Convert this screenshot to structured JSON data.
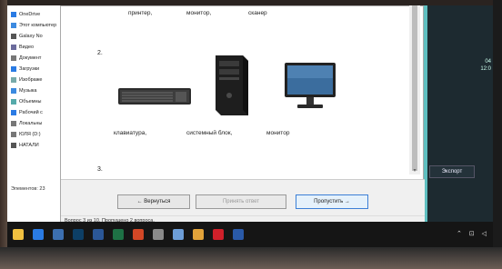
{
  "explorer": {
    "items": [
      {
        "label": "OneDrive",
        "icon": "cloud-icon",
        "color": "#2a7be4"
      },
      {
        "label": "Этот компьютер",
        "icon": "computer-icon",
        "color": "#3c8ae0"
      },
      {
        "label": "Galaxy No",
        "icon": "phone-icon",
        "color": "#555"
      },
      {
        "label": "Видео",
        "icon": "video-icon",
        "color": "#6b6b9c"
      },
      {
        "label": "Документ",
        "icon": "document-icon",
        "color": "#777"
      },
      {
        "label": "Загрузки",
        "icon": "download-icon",
        "color": "#2a7be4"
      },
      {
        "label": "Изображе",
        "icon": "image-icon",
        "color": "#7aa"
      },
      {
        "label": "Музыка",
        "icon": "music-icon",
        "color": "#3c8ae0"
      },
      {
        "label": "Объемны",
        "icon": "cube-icon",
        "color": "#5aa"
      },
      {
        "label": "Рабочий с",
        "icon": "desktop-icon",
        "color": "#2a7be4"
      },
      {
        "label": "Локальны",
        "icon": "drive-icon",
        "color": "#777"
      },
      {
        "label": "ЮЛЯ (D:)",
        "icon": "drive-icon",
        "color": "#777"
      },
      {
        "label": "НАТАЛИ",
        "icon": "usb-icon",
        "color": "#555"
      }
    ],
    "status": "Элементов: 23"
  },
  "question": {
    "top_captions": [
      "принтер,",
      "монитор,",
      "сканер"
    ],
    "item2_number": "2.",
    "item2_captions": [
      "клавиатура,",
      "системный блок,",
      "монитор"
    ],
    "item3_number": "3."
  },
  "buttons": {
    "back": "← Вернуться",
    "accept": "Принять ответ",
    "skip": "Пропустить →"
  },
  "progress_text": "Вопрос 3 из 10. Пропущено 2 вопроса.",
  "side": {
    "export_label": "Экспорт",
    "clock": "04 12:0"
  },
  "taskbar": {
    "icons": [
      {
        "name": "explorer-icon",
        "color": "#f0c040"
      },
      {
        "name": "mail-icon",
        "color": "#2a7be4"
      },
      {
        "name": "terminal-icon",
        "color": "#3c6fb0"
      },
      {
        "name": "photoshop-icon",
        "color": "#0d3f66"
      },
      {
        "name": "word-icon",
        "color": "#2b5797"
      },
      {
        "name": "excel-icon",
        "color": "#1e7145"
      },
      {
        "name": "powerpoint-icon",
        "color": "#d24726"
      },
      {
        "name": "calculator-icon",
        "color": "#8a8a8a"
      },
      {
        "name": "paint-icon",
        "color": "#6d9ed8"
      },
      {
        "name": "chrome-icon",
        "color": "#e2a33a"
      },
      {
        "name": "opera-icon",
        "color": "#d0202a"
      },
      {
        "name": "help-icon",
        "color": "#2a5aa8"
      }
    ],
    "tray": "⌃ ⊡ ◁"
  }
}
